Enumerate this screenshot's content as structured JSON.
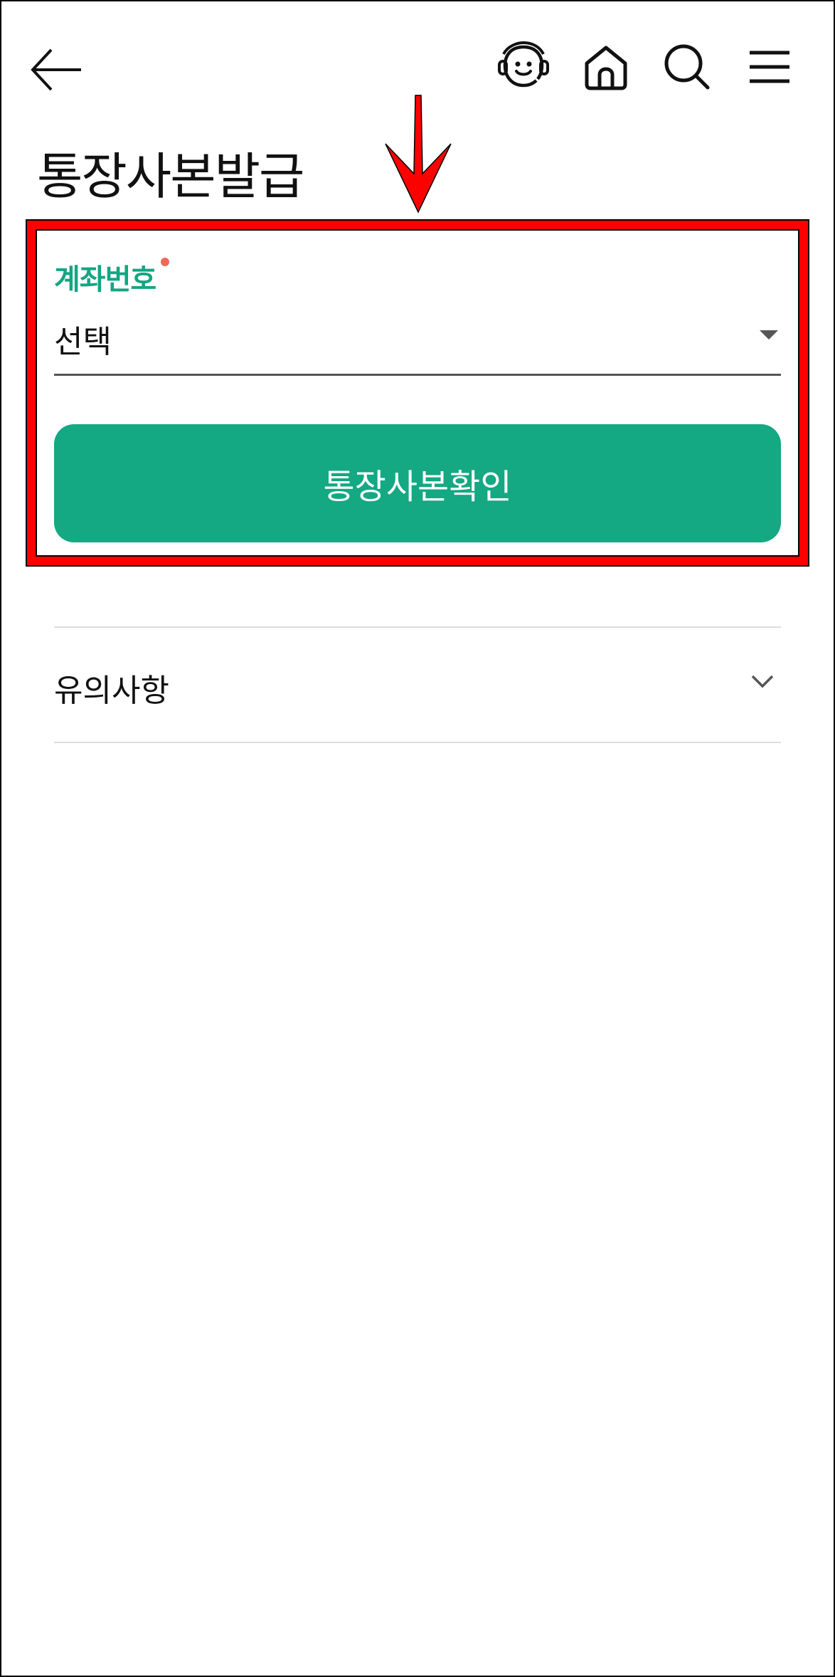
{
  "header": {
    "back_icon": "arrow-left-icon",
    "chatbot_icon": "chatbot-face-icon",
    "home_icon": "home-icon",
    "search_icon": "search-icon",
    "menu_icon": "hamburger-menu-icon"
  },
  "page": {
    "title": "통장사본발급"
  },
  "form": {
    "account_label": "계좌번호",
    "account_select_value": "선택",
    "confirm_button": "통장사본확인"
  },
  "notice": {
    "title": "유의사항"
  },
  "colors": {
    "brand_green": "#14a883",
    "label_green": "#14a583",
    "required_dot": "#f0685a",
    "annotation_red": "#ff0000"
  }
}
